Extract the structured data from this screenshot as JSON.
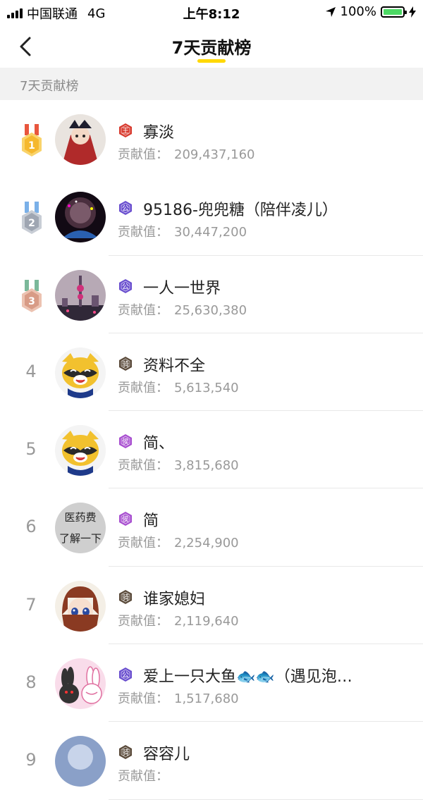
{
  "status_bar": {
    "carrier": "中国联通",
    "network": "4G",
    "time": "上午8:12",
    "battery": "100%"
  },
  "nav": {
    "title": "7天贡献榜"
  },
  "section": {
    "label": "7天贡献榜"
  },
  "contrib_label": "贡献值：",
  "rows": [
    {
      "rank": "1",
      "medal": "gold",
      "badge": "王",
      "badge_color": "#d83b2f",
      "name": "寡淡",
      "value": "209,437,160"
    },
    {
      "rank": "2",
      "medal": "silver",
      "badge": "公",
      "badge_color": "#6a4fcf",
      "name": "95186-兜兜糖（陪伴凌儿）",
      "value": "30,447,200"
    },
    {
      "rank": "3",
      "medal": "bronze",
      "badge": "公",
      "badge_color": "#6a4fcf",
      "name": "一人一世界",
      "value": "25,630,380"
    },
    {
      "rank": "4",
      "medal": "",
      "badge": "骑",
      "badge_color": "#5a4a3a",
      "name": "资料不全",
      "value": "5,613,540"
    },
    {
      "rank": "5",
      "medal": "",
      "badge": "侯",
      "badge_color": "#a84fd0",
      "name": "简、",
      "value": "3,815,680"
    },
    {
      "rank": "6",
      "medal": "",
      "badge": "侯",
      "badge_color": "#a84fd0",
      "name": "简",
      "value": "2,254,900"
    },
    {
      "rank": "7",
      "medal": "",
      "badge": "骑",
      "badge_color": "#5a4a3a",
      "name": "谁家媳妇",
      "value": "2,119,640"
    },
    {
      "rank": "8",
      "medal": "",
      "badge": "公",
      "badge_color": "#6a4fcf",
      "name": "爱上一只大鱼🐟🐟（遇见泡…",
      "value": "1,517,680"
    },
    {
      "rank": "9",
      "medal": "",
      "badge": "骑",
      "badge_color": "#5a4a3a",
      "name": "容容儿",
      "value": ""
    }
  ],
  "avatars": {
    "6": {
      "text": [
        "医药费",
        "了解一下"
      ]
    }
  },
  "icons": {
    "back": "chevron-left-icon",
    "location": "location-arrow-icon",
    "charging": "bolt-icon"
  }
}
